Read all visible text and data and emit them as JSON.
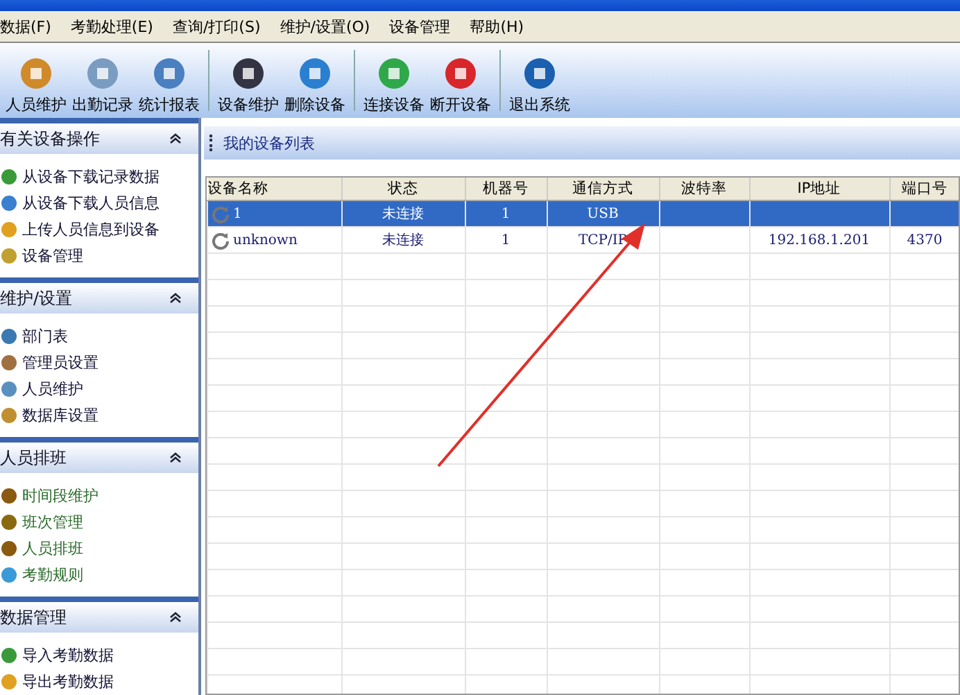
{
  "menu": [
    "数据(F)",
    "考勤处理(E)",
    "查询/打印(S)",
    "维护/设置(O)",
    "设备管理",
    "帮助(H)"
  ],
  "toolbar": [
    [
      "人员维护",
      "出勤记录",
      "统计报表"
    ],
    [
      "设备维护",
      "删除设备"
    ],
    [
      "连接设备",
      "断开设备"
    ],
    [
      "退出系统"
    ]
  ],
  "sidebar": [
    {
      "title": "有关设备操作",
      "items": [
        {
          "label": "从设备下载记录数据"
        },
        {
          "label": "从设备下载人员信息"
        },
        {
          "label": "上传人员信息到设备"
        },
        {
          "label": "设备管理"
        }
      ]
    },
    {
      "title": "维护/设置",
      "items": [
        {
          "label": "部门表"
        },
        {
          "label": "管理员设置"
        },
        {
          "label": "人员维护"
        },
        {
          "label": "数据库设置"
        }
      ]
    },
    {
      "title": "人员排班",
      "items": [
        {
          "label": "时间段维护"
        },
        {
          "label": "班次管理"
        },
        {
          "label": "人员排班"
        },
        {
          "label": "考勤规则"
        }
      ]
    },
    {
      "title": "数据管理",
      "items": [
        {
          "label": "导入考勤数据"
        },
        {
          "label": "导出考勤数据"
        }
      ]
    }
  ],
  "panel": {
    "title": "我的设备列表"
  },
  "table": {
    "columns": [
      "设备名称",
      "状态",
      "机器号",
      "通信方式",
      "波特率",
      "IP地址",
      "端口号"
    ],
    "rows": [
      {
        "selected": true,
        "cells": [
          "1",
          "未连接",
          "1",
          "USB",
          "",
          "",
          ""
        ]
      },
      {
        "selected": false,
        "cells": [
          "unknown",
          "未连接",
          "1",
          "TCP/IP",
          "",
          "192.168.1.201",
          "4370"
        ]
      }
    ]
  }
}
